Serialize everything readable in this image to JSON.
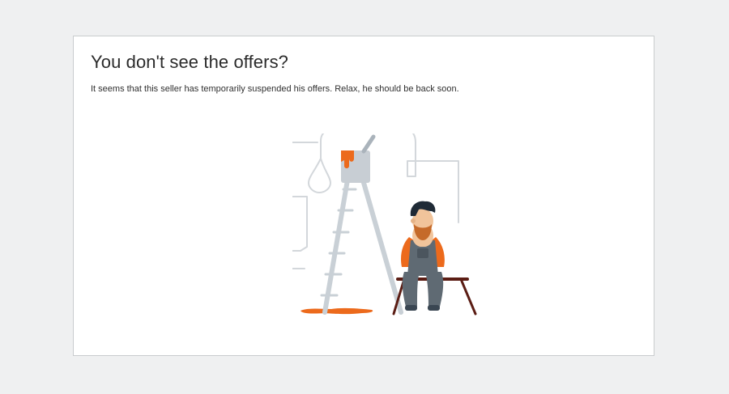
{
  "notice": {
    "title": "You don't see the offers?",
    "message": "It seems that this seller has temporarily suspended his offers. Relax, he should be back soon."
  },
  "illustration": {
    "subject": "painter-resting-beside-ladder",
    "colors": {
      "paint": "#ec6a1c",
      "ladder": "#c9d0d6",
      "line_art": "#d3d7db",
      "overalls": "#5f6a73",
      "bench": "#5b1d14",
      "hair": "#1f2a36",
      "skin": "#f1c49b"
    }
  }
}
